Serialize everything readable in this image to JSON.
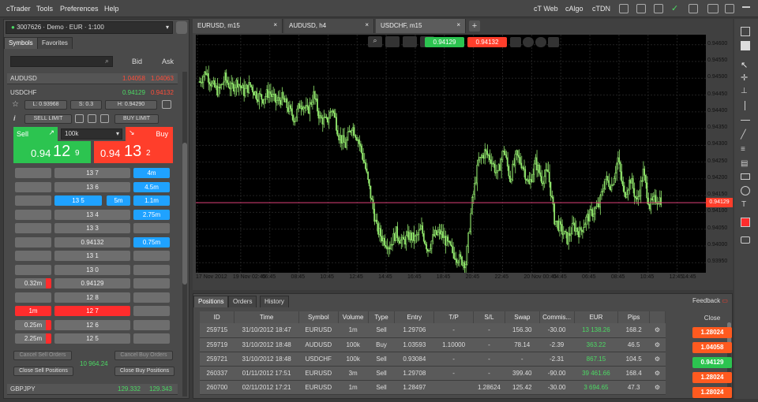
{
  "menu": {
    "items": [
      "cTrader",
      "Tools",
      "Preferences",
      "Help"
    ],
    "right": [
      "cT Web",
      "cAlgo",
      "cTDN"
    ]
  },
  "account": {
    "label": "3007626 · Demo · EUR · 1:100"
  },
  "left_tabs": [
    "Symbols",
    "Favorites"
  ],
  "watch_header": {
    "bid": "Bid",
    "ask": "Ask"
  },
  "symbols": [
    {
      "name": "AUDUSD",
      "bid": "1.04058",
      "ask": "1.04063"
    },
    {
      "name": "GBPJPY",
      "bid": "129.332",
      "ask": "129.343"
    }
  ],
  "usdchf": {
    "name": "USDCHF",
    "bid": "0.94129",
    "ask": "0.94132",
    "low": "L: 0.93968",
    "spread": "S: 0.3",
    "high": "H: 0.94290",
    "sell_limit": "SELL LIMIT",
    "buy_limit": "BUY LIMIT",
    "sell": "Sell",
    "buy": "Buy",
    "volume": "100k",
    "sell_price_a": "0.94",
    "sell_price_b": "12",
    "sell_price_c": "9",
    "buy_price_a": "0.94",
    "buy_price_b": "13",
    "buy_price_c": "2"
  },
  "ladder": [
    {
      "price": "13 7",
      "left": "",
      "right": "4m",
      "rtype": "blue"
    },
    {
      "price": "13 6",
      "left": "",
      "right": "4.5m",
      "rtype": "blue"
    },
    {
      "price": "13 5",
      "left": "5m",
      "right": "1.1m",
      "rtype": "blue",
      "mid_blue": true
    },
    {
      "price": "13 4",
      "left": "",
      "right": "2.75m",
      "rtype": "blue"
    },
    {
      "price": "13 3",
      "left": "",
      "right": "",
      "rtype": "gray"
    },
    {
      "price": "0.94132",
      "left": "",
      "right": "0.75m",
      "rtype": "blue"
    },
    {
      "price": "13 1",
      "left": "",
      "right": "",
      "rtype": ""
    },
    {
      "price": "13 0",
      "left": "",
      "right": "",
      "rtype": ""
    },
    {
      "price": "0.94129",
      "left": "0.32m",
      "right": "",
      "rtype": ""
    },
    {
      "price": "12 8",
      "left": "",
      "right": "",
      "rtype": ""
    },
    {
      "price": "12 7",
      "left": "1m",
      "right": "",
      "rtype": "",
      "red": true
    },
    {
      "price": "12 6",
      "left": "0.25m",
      "right": "",
      "rtype": ""
    },
    {
      "price": "12 5",
      "left": "2.25m",
      "right": "",
      "rtype": ""
    }
  ],
  "bottom_left": {
    "cancel_sell": "Cancel Sell Orders",
    "cancel_buy": "Cancel Buy Orders",
    "close_sell": "Close Sell Positions",
    "close_buy": "Close Buy Positions",
    "net": "10 964.24"
  },
  "chart_tabs": [
    "EURUSD, m15",
    "AUDUSD, h4",
    "USDCHF, m15"
  ],
  "chart_toolbar": {
    "bid": "0.94129",
    "ask": "0.94132"
  },
  "chart_data": {
    "type": "candlestick",
    "symbol": "USDCHF",
    "timeframe": "m15",
    "y_ticks": [
      "0.94600",
      "0.94550",
      "0.94500",
      "0.94450",
      "0.94400",
      "0.94350",
      "0.94300",
      "0.94250",
      "0.94200",
      "0.94150",
      "0.94100",
      "0.94050",
      "0.94000",
      "0.93950"
    ],
    "x_ticks": [
      "17 Nov 2012",
      "19 Nov 02:45",
      "06:45",
      "08:45",
      "10:45",
      "12:45",
      "14:45",
      "16:45",
      "18:45",
      "20:45",
      "22:45",
      "20 Nov 00:45",
      "04:45",
      "06:45",
      "08:45",
      "10:45",
      "12:45",
      "14:45"
    ],
    "ylim": [
      0.9392,
      0.9463
    ],
    "current_price": "0.94129",
    "close_path": [
      0.9449,
      0.9452,
      0.9448,
      0.9446,
      0.945,
      0.9447,
      0.9449,
      0.9446,
      0.9448,
      0.9445,
      0.9444,
      0.9446,
      0.9443,
      0.9444,
      0.9441,
      0.9438,
      0.9443,
      0.944,
      0.9445,
      0.9438,
      0.9437,
      0.9441,
      0.9433,
      0.943,
      0.9436,
      0.9432,
      0.9425,
      0.9415,
      0.9405,
      0.9402,
      0.94,
      0.9404,
      0.9401,
      0.9403,
      0.9402,
      0.9405,
      0.9399,
      0.9403,
      0.9404,
      0.9401,
      0.9398,
      0.9396,
      0.9395,
      0.9413,
      0.9425,
      0.9428,
      0.9426,
      0.9421,
      0.9429,
      0.942,
      0.9427,
      0.9424,
      0.9418,
      0.9425,
      0.942,
      0.9422,
      0.9408,
      0.9405,
      0.9402,
      0.9406,
      0.9404,
      0.9408,
      0.941,
      0.9412,
      0.942,
      0.9418,
      0.9426,
      0.9415,
      0.942,
      0.9413,
      0.9422,
      0.9412,
      0.9414
    ]
  },
  "bottom_tabs": [
    "Positions",
    "Orders",
    "History"
  ],
  "feedback": "Feedback",
  "positions": {
    "headers": [
      "ID",
      "Time",
      "Symbol",
      "Volume",
      "Type",
      "Entry",
      "T/P",
      "S/L",
      "Swap",
      "Commis...",
      "EUR",
      "Pips",
      "",
      "Close"
    ],
    "rows": [
      {
        "id": "259715",
        "time": "31/10/2012 18:47",
        "symbol": "EURUSD",
        "volume": "1m",
        "type": "Sell",
        "entry": "1.29706",
        "tp": "-",
        "sl": "-",
        "swap": "156.30",
        "comm": "-30.00",
        "eur": "13 138.26",
        "pips": "168.2",
        "close": "1.28024",
        "ctype": "red"
      },
      {
        "id": "259719",
        "time": "31/10/2012 18:48",
        "symbol": "AUDUSD",
        "volume": "100k",
        "type": "Buy",
        "entry": "1.03593",
        "tp": "1.10000",
        "sl": "-",
        "swap": "78.14",
        "comm": "-2.39",
        "eur": "363.22",
        "pips": "46.5",
        "close": "1.04058",
        "ctype": "red"
      },
      {
        "id": "259721",
        "time": "31/10/2012 18:48",
        "symbol": "USDCHF",
        "volume": "100k",
        "type": "Sell",
        "entry": "0.93084",
        "tp": "-",
        "sl": "-",
        "swap": "-",
        "comm": "-2.31",
        "eur": "867.15",
        "pips": "104.5",
        "close": "0.94129",
        "ctype": "green"
      },
      {
        "id": "260337",
        "time": "01/11/2012 17:51",
        "symbol": "EURUSD",
        "volume": "3m",
        "type": "Sell",
        "entry": "1.29708",
        "tp": "-",
        "sl": "-",
        "swap": "399.40",
        "comm": "-90.00",
        "eur": "39 461.66",
        "pips": "168.4",
        "close": "1.28024",
        "ctype": "red"
      },
      {
        "id": "260700",
        "time": "02/11/2012 17:21",
        "symbol": "EURUSD",
        "volume": "1m",
        "type": "Sell",
        "entry": "1.28497",
        "tp": "",
        "sl": "1.28624",
        "swap": "125.42",
        "comm": "-30.00",
        "eur": "3 694.65",
        "pips": "47.3",
        "close": "1.28024",
        "ctype": "red"
      }
    ]
  }
}
